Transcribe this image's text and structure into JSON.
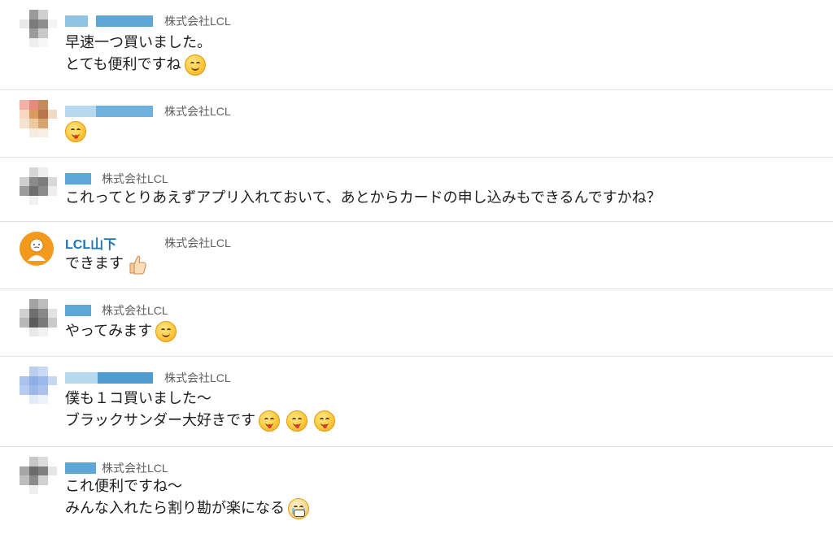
{
  "colors": {
    "link": "#1a76b8",
    "org": "#616061",
    "divider": "#dddddd",
    "avatar_orange": "#f39a1e"
  },
  "messages": [
    {
      "org": "株式会社LCL",
      "lines": [
        "早速一つ買いました。",
        "とても便利ですね"
      ],
      "emoji": [
        "smile"
      ]
    },
    {
      "org": "株式会社LCL",
      "lines": [
        ""
      ],
      "emoji": [
        "tongue"
      ]
    },
    {
      "org": "株式会社LCL",
      "lines": [
        "これってとりあえずアプリ入れておいて、あとからカードの申し込みもできるんですかね？"
      ]
    },
    {
      "author": "LCL山下",
      "org": "株式会社LCL",
      "lines": [
        "できます"
      ],
      "emoji": [
        "thumbs-up"
      ]
    },
    {
      "org": "株式会社LCL",
      "lines": [
        "やってみます"
      ],
      "emoji": [
        "smile"
      ]
    },
    {
      "org": "株式会社LCL",
      "lines": [
        "僕も１コ買いました〜",
        "ブラックサンダー大好きです"
      ],
      "emoji": [
        "tongue",
        "tongue",
        "tongue"
      ]
    },
    {
      "org": "株式会社LCL",
      "lines": [
        "これ便利ですね〜",
        "みんな入れたら割り勘が楽になる"
      ],
      "emoji": [
        "crying-laugh"
      ]
    }
  ]
}
